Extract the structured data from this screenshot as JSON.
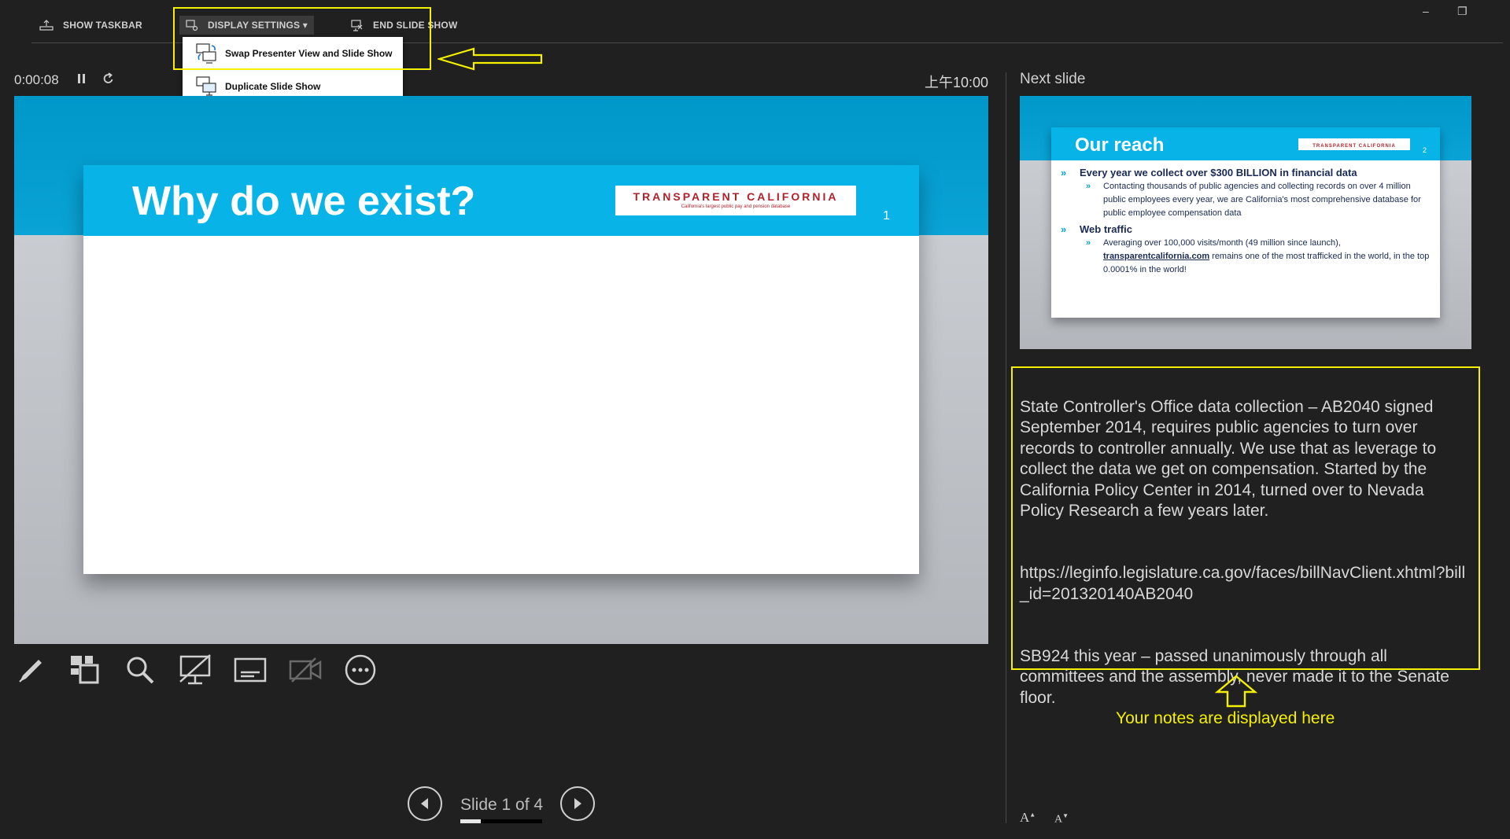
{
  "toolbar": {
    "show_taskbar": "SHOW TASKBAR",
    "display_settings": "DISPLAY SETTINGS ▾",
    "end_slide_show": "END SLIDE SHOW"
  },
  "display_menu": {
    "swap": "Swap Presenter View and Slide Show",
    "duplicate": "Duplicate Slide Show"
  },
  "timer": "0:00:08",
  "clock": "上午10:00",
  "current_slide": {
    "title": "Why do we exist?",
    "logo_main": "TRANSPARENT CALIFORNIA",
    "logo_sub": "California's largest public pay and pension database",
    "number": "1"
  },
  "navigation": {
    "slide_counter": "Slide 1 of 4",
    "progress_fraction": 0.25
  },
  "next_slide": {
    "label": "Next slide",
    "title": "Our reach",
    "logo_main": "TRANSPARENT CALIFORNIA",
    "number": "2",
    "bullet1": "Every year we collect over $300 BILLION in financial data",
    "bullet1_sub": "Contacting thousands of public agencies and collecting records on over 4 million public employees every year, we are California's most comprehensive database for public employee compensation data",
    "bullet2": "Web traffic",
    "bullet2_sub_before": "Averaging over 100,000 visits/month (49 million since launch), ",
    "bullet2_link": "transparentcalifornia.com",
    "bullet2_sub_after": " remains one of the most trafficked in the world, in the top 0.0001% in the world!"
  },
  "notes": {
    "para1": "State Controller's Office data collection – AB2040 signed September 2014, requires public agencies to turn over records to controller annually.  We use that as leverage to collect the data we get on compensation.  Started by the California Policy Center in 2014, turned over to Nevada Policy Research a few years later.",
    "para2": "https://leginfo.legislature.ca.gov/faces/billNavClient.xhtml?bill_id=201320140AB2040",
    "para3": "SB924 this year – passed unanimously through all committees and the assembly, never made it to the Senate floor."
  },
  "callout": "Your notes are displayed here",
  "font_controls": {
    "increase": "A",
    "decrease": "A"
  },
  "colors": {
    "highlight": "#f4f000",
    "slide_header": "#08b3e8",
    "logo_red": "#b0212b"
  }
}
